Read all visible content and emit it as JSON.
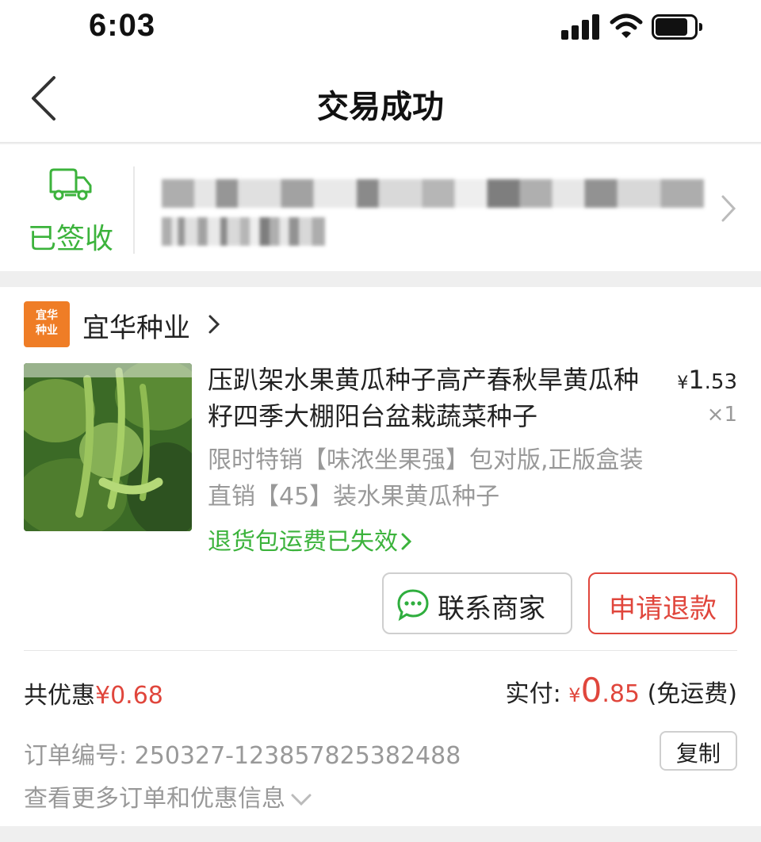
{
  "status_bar": {
    "time": "6:03"
  },
  "nav": {
    "title": "交易成功"
  },
  "delivery": {
    "status": "已签收"
  },
  "store": {
    "logo_text_line1": "宜华",
    "logo_text_line2": "种业",
    "name": "宜华种业"
  },
  "product": {
    "title": "压趴架水果黄瓜种子高产春秋旱黄瓜种籽四季大棚阳台盆栽蔬菜种子",
    "price_currency": "¥",
    "price_int": "1",
    "price_dec": ".53",
    "quantity": "×1",
    "sku": "限时特销【味浓坐果强】包对版,正版盒装直销【45】装水果黄瓜种子",
    "return_note": "退货包运费已失效"
  },
  "actions": {
    "contact": "联系商家",
    "refund": "申请退款"
  },
  "summary": {
    "discount_label": "共优惠",
    "discount_amount": "¥0.68",
    "paid_label": "实付:",
    "paid_currency": "¥",
    "paid_int": "0",
    "paid_dec": ".85",
    "shipping_note": "(免运费)"
  },
  "order": {
    "number_label": "订单编号:",
    "number": "250327-123857825382488",
    "copy_label": "复制",
    "more_info": "查看更多订单和优惠信息"
  }
}
